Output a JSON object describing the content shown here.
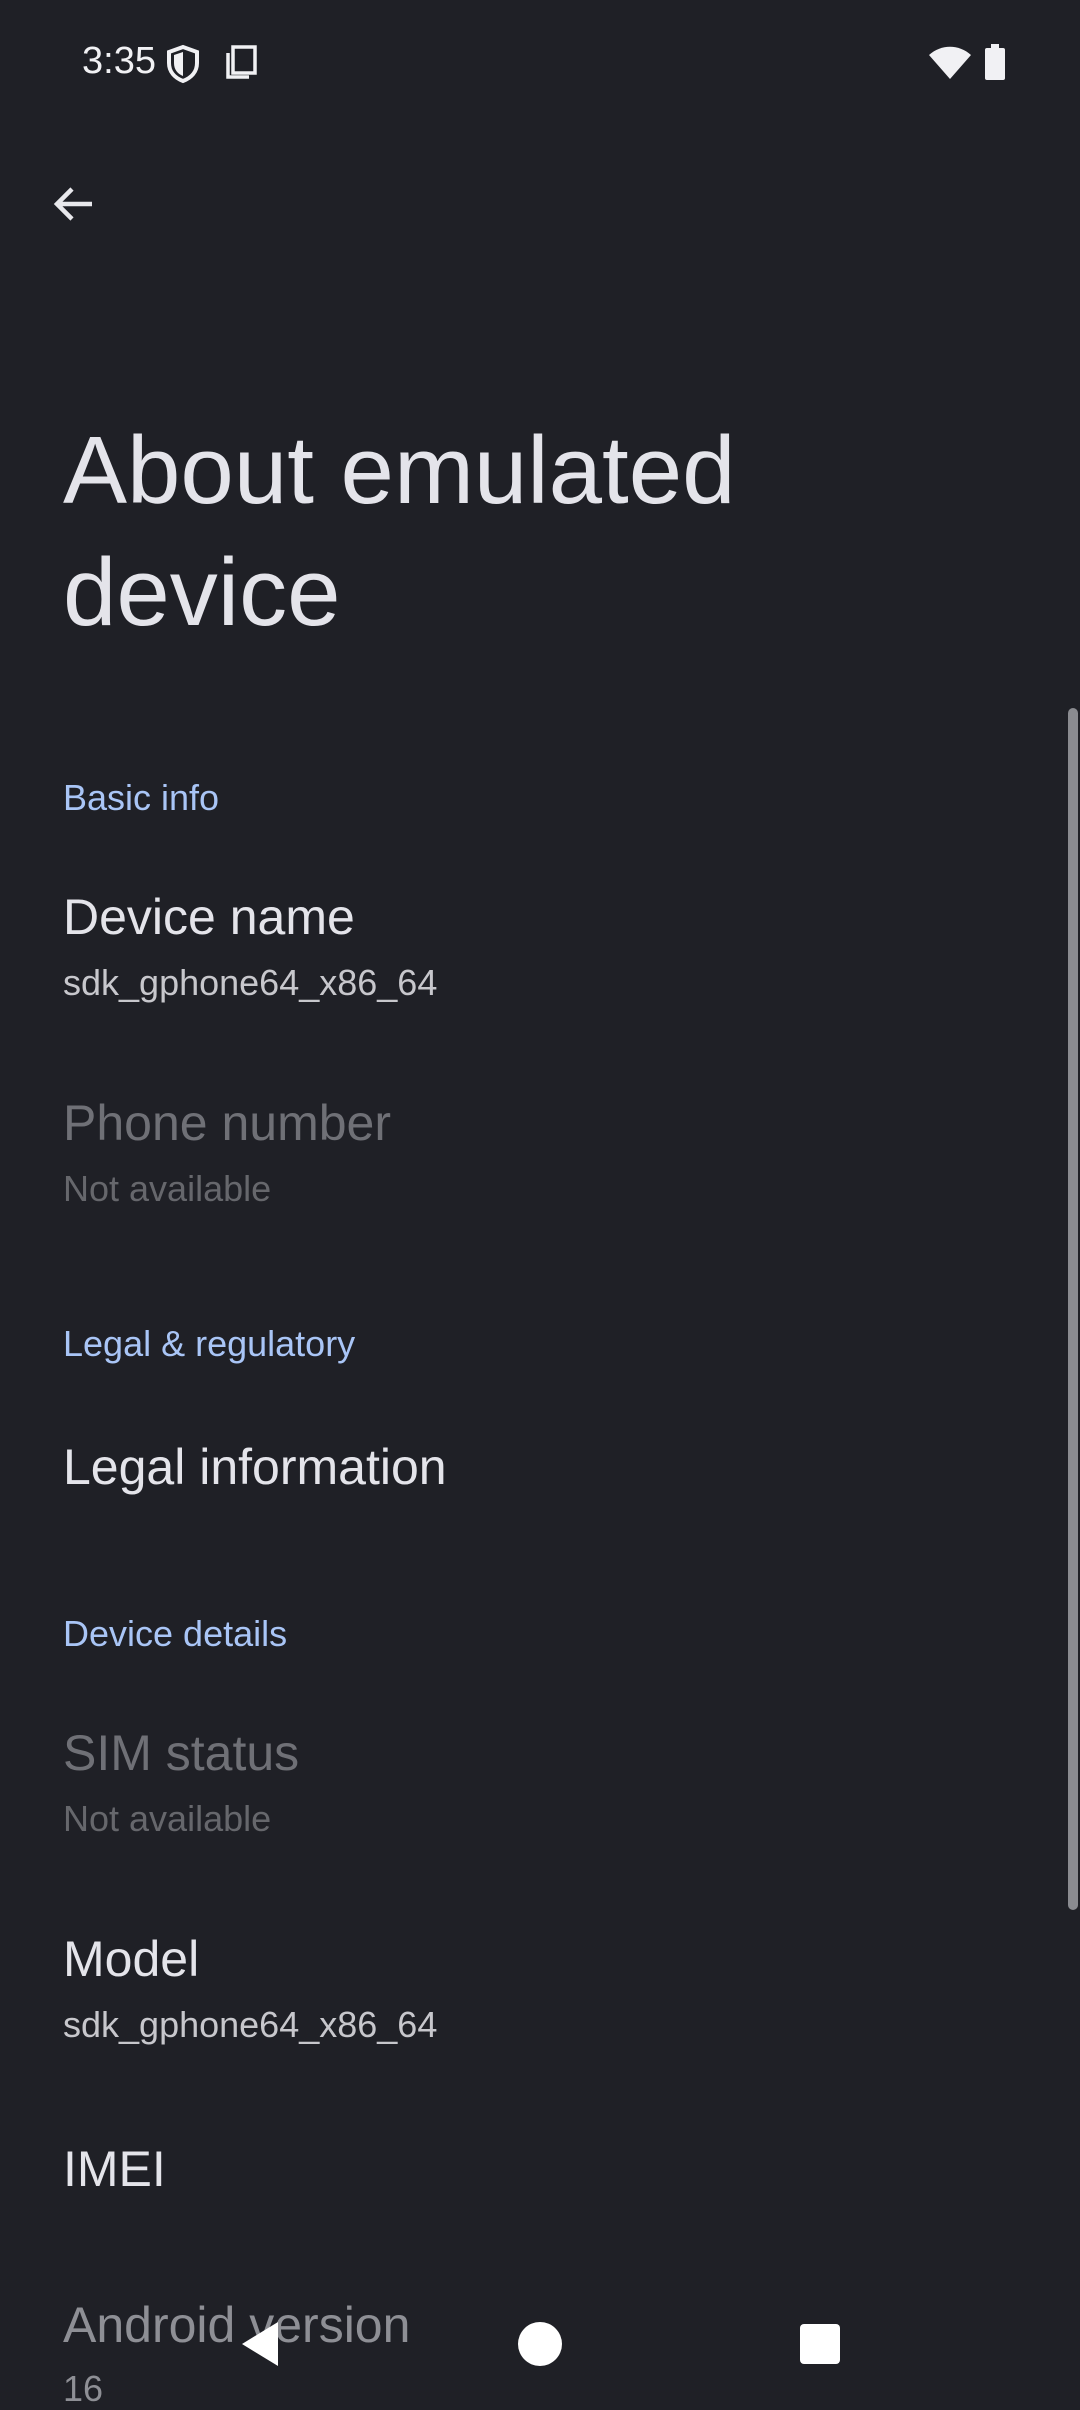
{
  "status_bar": {
    "time": "3:35",
    "icons": [
      "shield-icon",
      "screenshot-icon",
      "wifi-icon",
      "battery-icon"
    ]
  },
  "app_bar": {
    "back_icon": "arrow-back-icon"
  },
  "page": {
    "title": "About emulated device"
  },
  "sections": [
    {
      "header": "Basic info",
      "items": [
        {
          "title": "Device name",
          "summary": "sdk_gphone64_x86_64",
          "enabled": true
        },
        {
          "title": "Phone number",
          "summary": "Not available",
          "enabled": false
        }
      ]
    },
    {
      "header": "Legal & regulatory",
      "items": [
        {
          "title": "Legal information",
          "enabled": true
        }
      ]
    },
    {
      "header": "Device details",
      "items": [
        {
          "title": "SIM status",
          "summary": "Not available",
          "enabled": false
        },
        {
          "title": "Model",
          "summary": "sdk_gphone64_x86_64",
          "enabled": true
        },
        {
          "title": "IMEI",
          "enabled": true
        },
        {
          "title": "Android version",
          "summary": "16",
          "enabled": true
        }
      ]
    }
  ],
  "nav_bar": {
    "icons": [
      "nav-back-icon",
      "nav-home-icon",
      "nav-recents-icon"
    ]
  },
  "colors": {
    "background": "#1f2026",
    "accent": "#a9c5f6",
    "text_primary": "#e4e4ea",
    "text_disabled": "#6f7076"
  }
}
